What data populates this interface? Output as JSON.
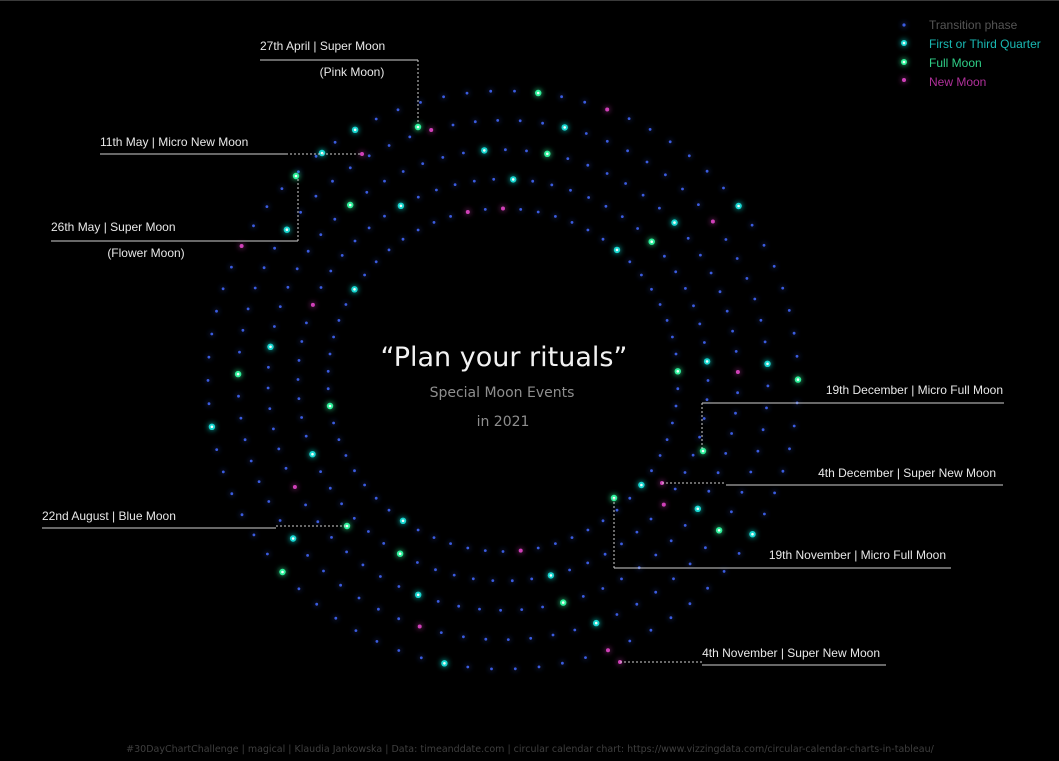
{
  "chart_data": {
    "type": "scatter",
    "title": "“Plan your rituals”",
    "subtitle_line1": "Special Moon Events",
    "subtitle_line2": "in 2021",
    "legend": [
      {
        "key": "transition",
        "label": "Transition phase",
        "color": "#3a5be0",
        "text_color": "#555555"
      },
      {
        "key": "quarter",
        "label": "First or Third Quarter",
        "color": "#19d6d0",
        "text_color": "#19b9b4"
      },
      {
        "key": "full",
        "label": "Full Moon",
        "color": "#2ff09a",
        "text_color": "#2fd088"
      },
      {
        "key": "new",
        "label": "New Moon",
        "color": "#d040b8",
        "text_color": "#b0309a"
      }
    ],
    "annotations": [
      {
        "line1": "27th April | Super Moon",
        "line2": "(Pink Moon)"
      },
      {
        "line1": "11th May | Micro New Moon",
        "line2": ""
      },
      {
        "line1": "26th May | Super Moon",
        "line2": "(Flower Moon)"
      },
      {
        "line1": "22nd August | Blue Moon",
        "line2": ""
      },
      {
        "line1": "19th December | Micro Full Moon",
        "line2": ""
      },
      {
        "line1": "4th December | Super New Moon",
        "line2": ""
      },
      {
        "line1": "19th November | Micro Full Moon",
        "line2": ""
      },
      {
        "line1": "4th November | Super New Moon",
        "line2": ""
      }
    ],
    "footer": "#30DayChartChallenge  |  magical  |  Klaudia Jankowska  |  Data: timeanddate.com  |  circular calendar chart: https://www.vizzingdata.com/circular-calendar-charts-in-tableau/"
  }
}
